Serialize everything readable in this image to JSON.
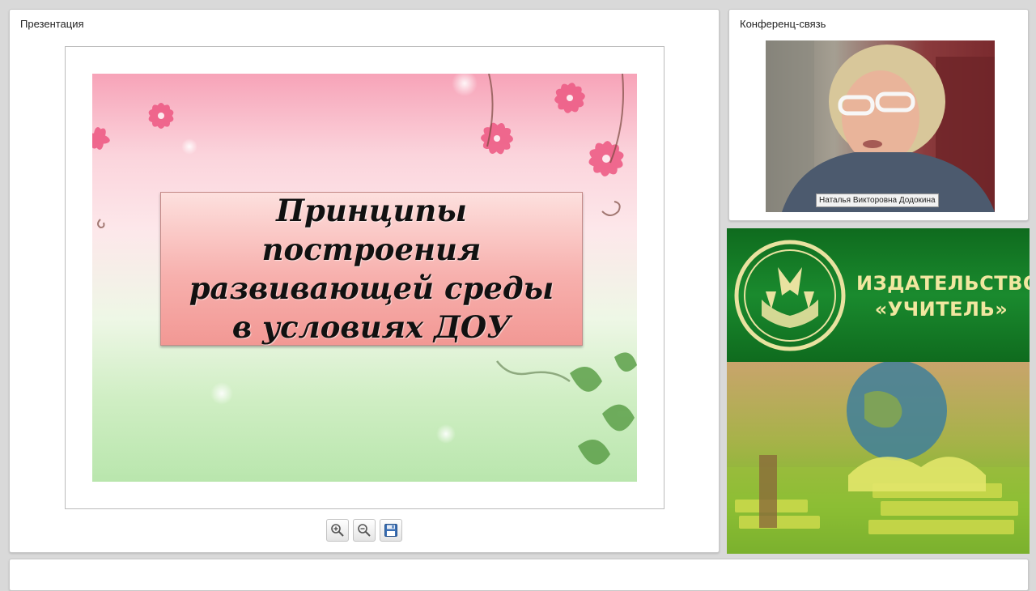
{
  "presentation": {
    "panel_title": "Презентация",
    "slide": {
      "title_lines": [
        "Принципы",
        "построения",
        "развивающей среды",
        "в условиях ДОУ"
      ]
    },
    "toolbar": {
      "zoom_in_icon": "zoom-in-icon",
      "zoom_out_icon": "zoom-out-icon",
      "save_icon": "floppy-disk-icon"
    }
  },
  "conference": {
    "panel_title": "Конференц-связь",
    "speaker_name": "Наталья Викторовна Додокина"
  },
  "banner": {
    "publisher_line1": "ИЗДАТЕЛЬСТВО",
    "publisher_line2": "«УЧИТЕЛЬ»",
    "logo_ring_color": "#e9e2a0",
    "background_color": "#1a8a2e"
  }
}
